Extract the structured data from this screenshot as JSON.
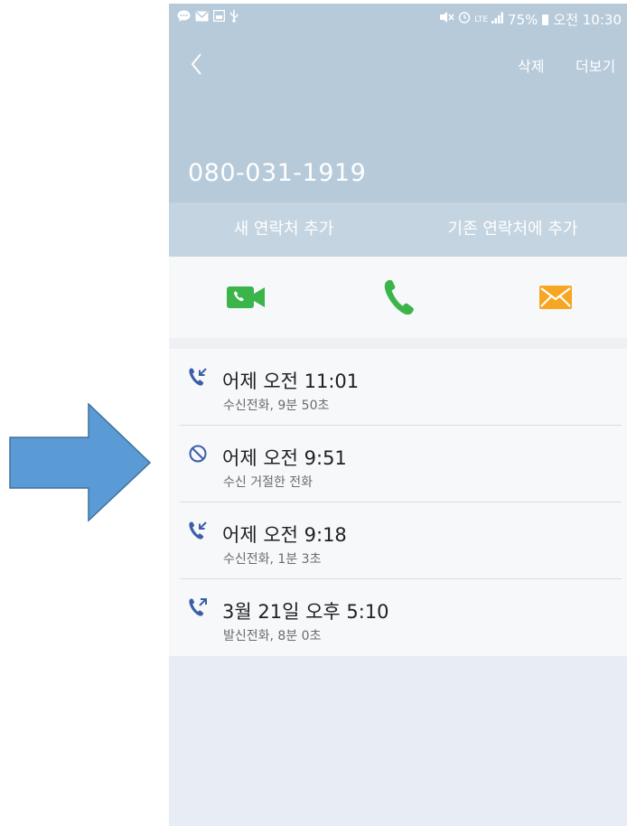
{
  "status_bar": {
    "battery": "75%",
    "time": "오전 10:30",
    "network": "LTE"
  },
  "header": {
    "delete_label": "삭제",
    "more_label": "더보기",
    "phone_number": "080-031-1919"
  },
  "contact_actions": {
    "add_new": "새 연락처 추가",
    "add_existing": "기존 연락처에 추가"
  },
  "quick_actions": [
    {
      "name": "video-call",
      "icon": "video-call-icon",
      "color": "#3bb54a"
    },
    {
      "name": "voice-call",
      "icon": "phone-icon",
      "color": "#3bb54a"
    },
    {
      "name": "message",
      "icon": "envelope-icon",
      "color": "#f6a623"
    }
  ],
  "call_log": [
    {
      "type": "incoming",
      "icon": "incoming-call-icon",
      "time": "어제 오전 11:01",
      "detail": "수신전화, 9분 50초"
    },
    {
      "type": "rejected",
      "icon": "blocked-icon",
      "time": "어제 오전 9:51",
      "detail": "수신 거절한 전화"
    },
    {
      "type": "incoming",
      "icon": "incoming-call-icon",
      "time": "어제 오전 9:18",
      "detail": "수신전화, 1분 3초"
    },
    {
      "type": "outgoing",
      "icon": "outgoing-call-icon",
      "time": "3월 21일 오후 5:10",
      "detail": "발신전화, 8분 0초"
    }
  ],
  "colors": {
    "header_bg": "#b7cad9",
    "call_icon_blue": "#3a5ea8",
    "arrow_fill": "#5b9bd5",
    "arrow_stroke": "#41719c"
  }
}
